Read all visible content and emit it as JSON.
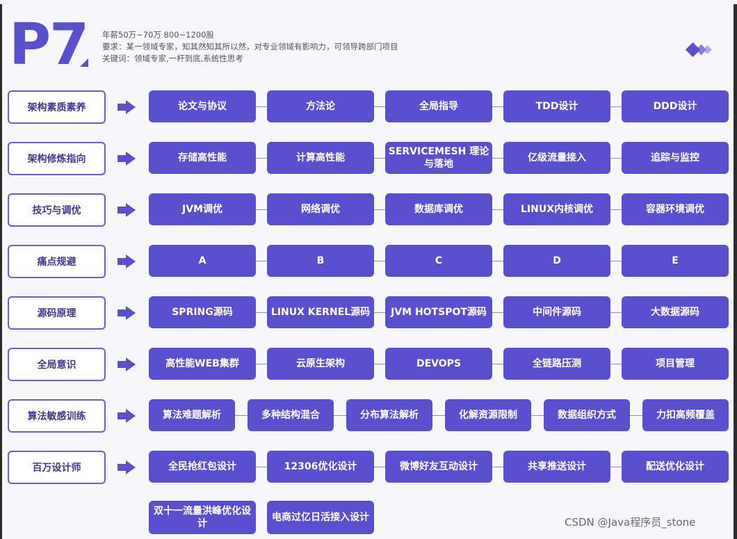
{
  "header": {
    "level": "P7",
    "salary": "年薪50万~70万 800~1200股",
    "requirement": "要求：某一领域专家，知其然知其所以然，对专业领域有影响力，可领导跨部门项目",
    "keywords": "关键词：领域专家,一杆到底,系统性思考"
  },
  "rows": [
    {
      "category": "架构素质素养",
      "items": [
        "论文与协议",
        "方法论",
        "全局指导",
        "TDD设计",
        "DDD设计"
      ]
    },
    {
      "category": "架构修炼指向",
      "items": [
        "存储高性能",
        "计算高性能",
        "SERVICEMESH 理论与落地",
        "亿级流量接入",
        "追踪与监控"
      ]
    },
    {
      "category": "技巧与调优",
      "items": [
        "JVM调优",
        "网络调优",
        "数据库调优",
        "LINUX内核调优",
        "容器环境调优"
      ]
    },
    {
      "category": "痛点规避",
      "items": [
        "A",
        "B",
        "C",
        "D",
        "E"
      ]
    },
    {
      "category": "源码原理",
      "items": [
        "SPRING源码",
        "LINUX KERNEL源码",
        "JVM HOTSPOT源码",
        "中间件源码",
        "大数据源码"
      ]
    },
    {
      "category": "全局意识",
      "items": [
        "高性能WEB集群",
        "云原生架构",
        "DEVOPS",
        "全链路压测",
        "项目管理"
      ]
    },
    {
      "category": "算法敏感训练",
      "items": [
        "算法难题解析",
        "多种结构混合",
        "分布算法解析",
        "化解资源限制",
        "数据组织方式",
        "力扣高频覆盖"
      ]
    },
    {
      "category": "百万设计师",
      "items": [
        "全民抢红包设计",
        "12306优化设计",
        "微博好友互动设计",
        "共享推送设计",
        "配送优化设计"
      ]
    },
    {
      "category": "",
      "items": [
        "双十一流量洪峰优化设计",
        "电商过亿日活接入设计"
      ]
    }
  ],
  "watermark": "CSDN @Java程序员_stone",
  "colors": {
    "accent": "#5a4fcf",
    "box_text": "#ffffff",
    "background": "#f7f7fb"
  }
}
